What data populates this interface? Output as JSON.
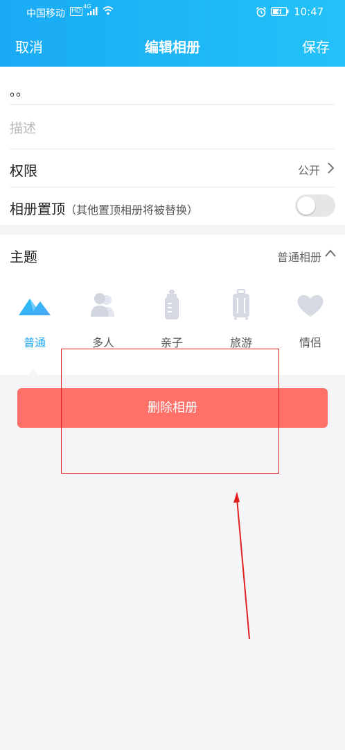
{
  "status_bar": {
    "carrier": "中国移动",
    "hd_badge": "HD",
    "network": "4G",
    "time": "10:47"
  },
  "nav": {
    "cancel_label": "取消",
    "title": "编辑相册",
    "save_label": "保存"
  },
  "form": {
    "album_name_value": "。。",
    "description_placeholder": "描述",
    "permission_label": "权限",
    "permission_value": "公开",
    "pin_label": "相册置顶",
    "pin_hint": "（其他置顶相册将被替换）",
    "pin_enabled": false
  },
  "theme": {
    "label": "主题",
    "selected_value": "普通相册",
    "options": [
      {
        "label": "普通",
        "icon": "mountain-icon",
        "active": true
      },
      {
        "label": "多人",
        "icon": "people-icon",
        "active": false
      },
      {
        "label": "亲子",
        "icon": "baby-bottle-icon",
        "active": false
      },
      {
        "label": "旅游",
        "icon": "luggage-icon",
        "active": false
      },
      {
        "label": "情侣",
        "icon": "heart-icon",
        "active": false
      }
    ]
  },
  "delete_button_label": "删除相册",
  "colors": {
    "header_gradient_start": "#19aaf3",
    "header_gradient_end": "#22c2f9",
    "accent": "#1ba8ef",
    "delete_button": "#fe7068",
    "annotation": "#e02020"
  }
}
